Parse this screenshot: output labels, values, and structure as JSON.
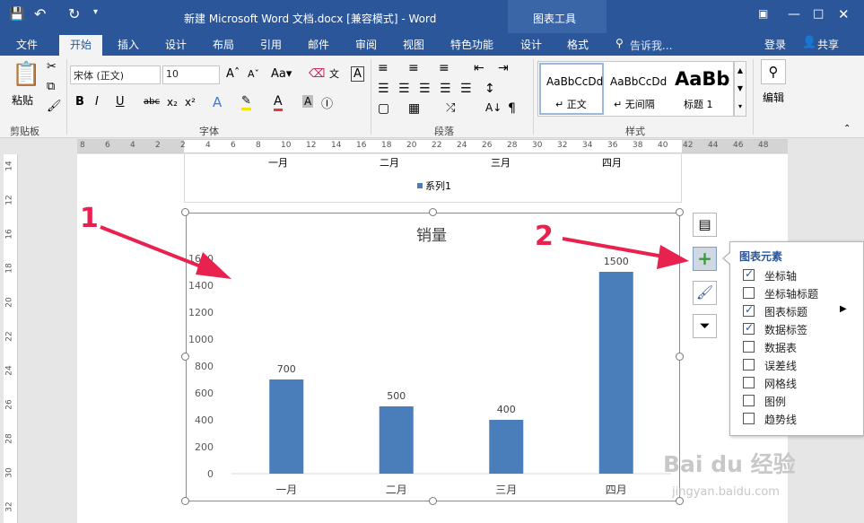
{
  "titlebar": {
    "title": "新建 Microsoft Word 文档.docx [兼容模式] - Word",
    "chart_tools": "图表工具"
  },
  "tabs": [
    "文件",
    "开始",
    "插入",
    "设计",
    "布局",
    "引用",
    "邮件",
    "审阅",
    "视图",
    "特色功能",
    "设计",
    "格式"
  ],
  "tell_me": "告诉我...",
  "login": "登录",
  "share": "共享",
  "ribbon": {
    "paste": "粘贴",
    "clipboard": "剪贴板",
    "font_name": "宋体 (正文)",
    "font_size": "10",
    "font": "字体",
    "paragraph": "段落",
    "styles": [
      {
        "preview": "AaBbCcDd",
        "name": "↵ 正文"
      },
      {
        "preview": "AaBbCcDd",
        "name": "↵ 无间隔"
      },
      {
        "preview": "AaBb",
        "name": "标题 1"
      }
    ],
    "styles_group": "样式",
    "edit": "编辑"
  },
  "ruler": [
    "8",
    "6",
    "4",
    "2",
    "2",
    "4",
    "6",
    "8",
    "10",
    "12",
    "14",
    "16",
    "18",
    "20",
    "22",
    "24",
    "26",
    "28",
    "30",
    "32",
    "34",
    "36",
    "38",
    "40",
    "42",
    "44",
    "46",
    "48"
  ],
  "vruler": [
    "14",
    "12",
    "16",
    "18",
    "20",
    "22",
    "24",
    "26",
    "28",
    "30",
    "32"
  ],
  "chart_top": {
    "months": [
      "一月",
      "二月",
      "三月",
      "四月"
    ],
    "legend": "系列1"
  },
  "chart_data": {
    "type": "bar",
    "title": "销量",
    "categories": [
      "一月",
      "二月",
      "三月",
      "四月"
    ],
    "values": [
      700,
      500,
      400,
      1500
    ],
    "ylim": [
      0,
      1600
    ],
    "yticks": [
      "0",
      "200",
      "400",
      "600",
      "800",
      "1000",
      "1200",
      "1400",
      "1600"
    ],
    "color": "#4a7ebb"
  },
  "elements_panel": {
    "title": "图表元素",
    "items": [
      {
        "label": "坐标轴",
        "checked": true
      },
      {
        "label": "坐标轴标题",
        "checked": false
      },
      {
        "label": "图表标题",
        "checked": true
      },
      {
        "label": "数据标签",
        "checked": true
      },
      {
        "label": "数据表",
        "checked": false
      },
      {
        "label": "误差线",
        "checked": false
      },
      {
        "label": "网格线",
        "checked": false
      },
      {
        "label": "图例",
        "checked": false
      },
      {
        "label": "趋势线",
        "checked": false
      }
    ]
  },
  "annotations": [
    "1",
    "2"
  ],
  "watermark": {
    "logo": "Bai du 经验",
    "url": "jingyan.baidu.com"
  }
}
